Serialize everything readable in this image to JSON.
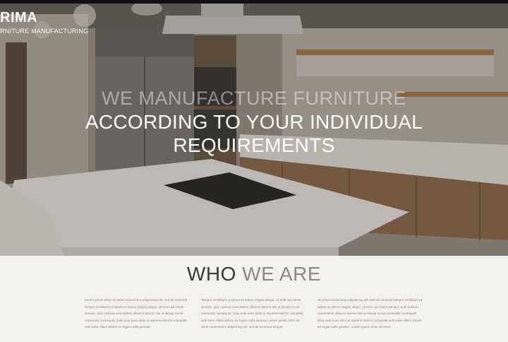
{
  "brand": {
    "name": "RIMA",
    "tagline": "RNITURE MANUFACTURING"
  },
  "hero": {
    "line1": "WE MANUFACTURE FURNITURE",
    "line2": "ACCORDING TO YOUR INDIVIDUAL",
    "line3": "REQUIREMENTS"
  },
  "about": {
    "title_strong": "WHO",
    "title_light": "WE ARE",
    "columns": [
      "Lorem ipsum dolor sit amet consectetur adipisicing elit, sed do eiusmod tempor incididunt ut labore et dolore magna aliqua. Ut enim ad minim veniam, quis nostrud exercitation ullamco laboris nisi ut aliquip ex ea commodo consequat. Duis aute irure dolor in reprehenderit in voluptate velit esse cillum dolore eu fugiat nulla pariatur.",
      "Tempor incididunt ut labore et dolore magna aliqua. Ut enim ad minim veniam, quis nostrud exercitation ullamco laboris nisi ut aliquip ex ea commodo consequat. Duis aute irure dolor in reprehenderit in voluptate velit esse cillum dolore eu fugiat nulla pariatur. Lorem ipsum dolor sit amet consectetur adipisicing elit, sed do eiusmod tempor.",
      "Sit amet consectetur adipisicing elit, sed do eiusmod tempor incididunt ut labore et dolore magna aliqua. Ut enim ad minim veniam, quis nostrud exercitation ullamco laboris nisi ut aliquip ex ea commodo consequat. Duis aute irure dolor in reprehenderit in voluptate velit esse cillum dolore eu fugiat nulla pariatur. Lorem ipsum dolor sit amet."
    ]
  }
}
